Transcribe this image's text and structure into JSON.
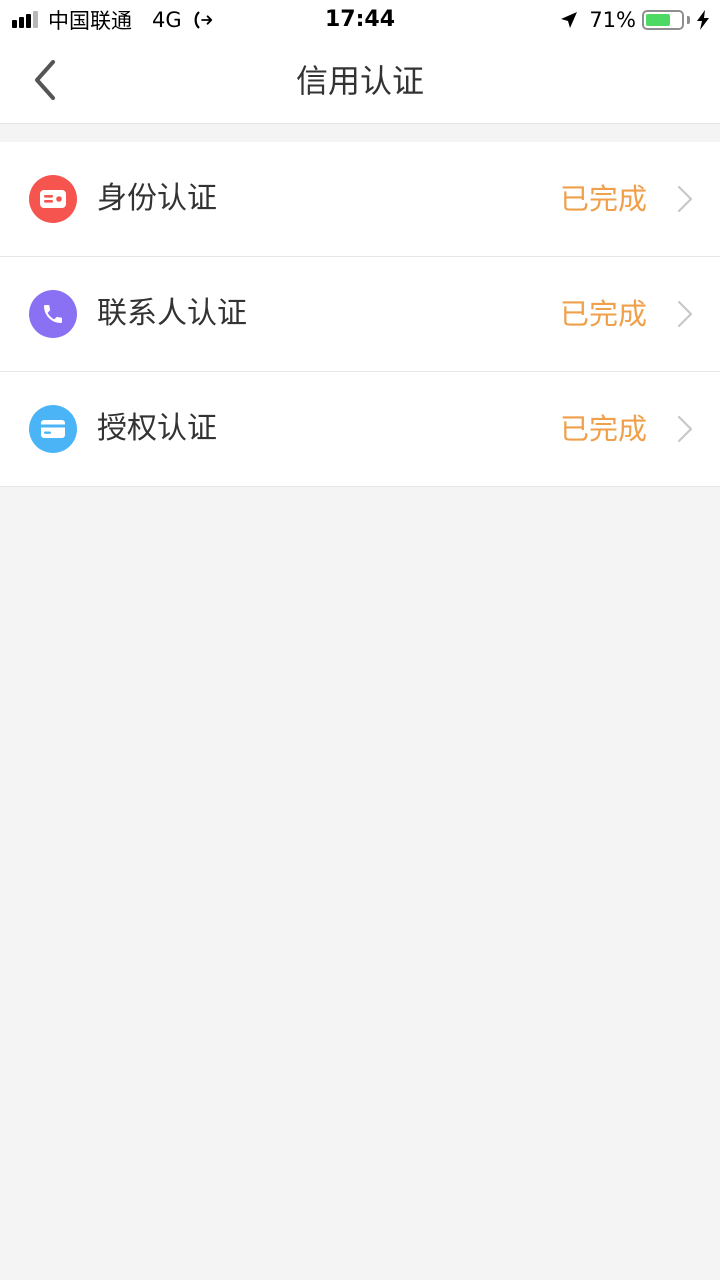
{
  "status_bar": {
    "carrier": "中国联通",
    "network": "4G",
    "time": "17:44",
    "battery_percent_text": "71%",
    "battery_level": 0.71,
    "signal_bars": 3,
    "signal_max": 4,
    "icons": [
      "call-forwarding-icon",
      "location-arrow-icon",
      "battery-icon",
      "charging-bolt-icon"
    ]
  },
  "header": {
    "title": "信用认证",
    "back_icon": "chevron-left-icon"
  },
  "items": [
    {
      "label": "身份认证",
      "status": "已完成",
      "icon": "id-card-icon",
      "icon_color": "#f6544e"
    },
    {
      "label": "联系人认证",
      "status": "已完成",
      "icon": "phone-icon",
      "icon_color": "#8a70f2"
    },
    {
      "label": "授权认证",
      "status": "已完成",
      "icon": "credit-card-icon",
      "icon_color": "#4ab4f6"
    }
  ],
  "colors": {
    "status_text": "#f0a04b",
    "page_background": "#f4f4f4",
    "chevron": "#c8c8c8"
  }
}
